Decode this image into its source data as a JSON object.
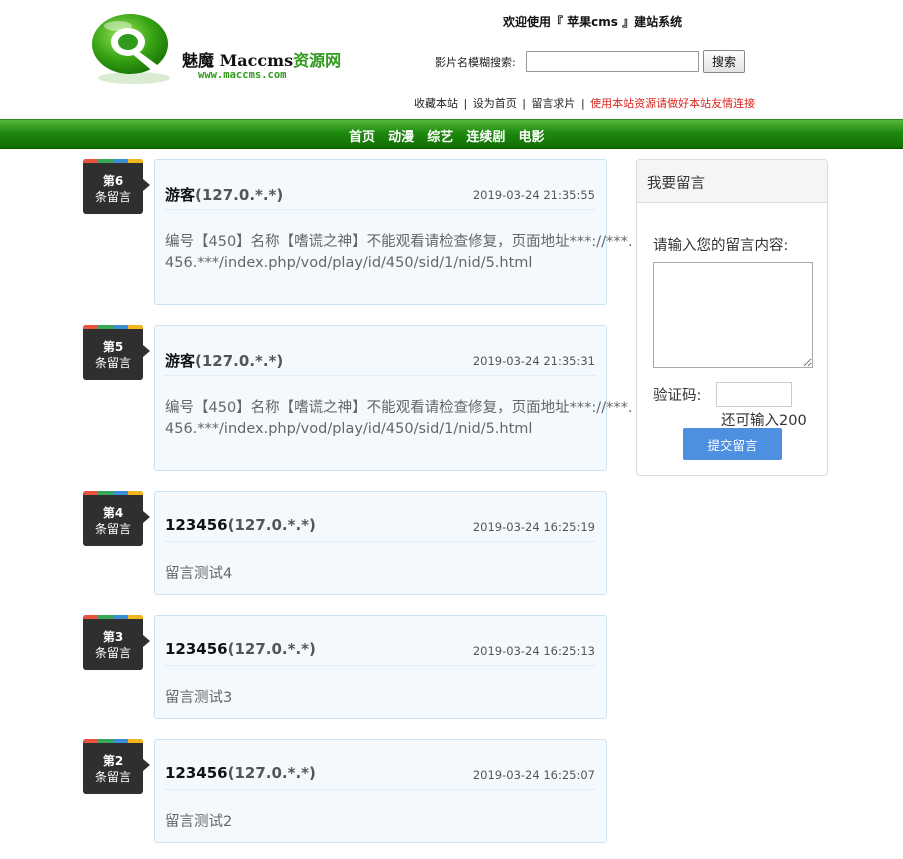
{
  "header": {
    "logo": {
      "name_black": "魅魔 Maccms",
      "name_green": "资源网",
      "url": "www.maccms.com"
    },
    "welcome": "欢迎使用『 苹果cms 』建站系统",
    "search": {
      "label": "影片名模糊搜索:",
      "value": "",
      "button": "搜索"
    },
    "links": [
      {
        "label": "收藏本站",
        "color": "#222222"
      },
      {
        "label": "设为首页",
        "color": "#222222"
      },
      {
        "label": "留言求片",
        "color": "#222222"
      },
      {
        "label": "使用本站资源请做好本站友情连接",
        "color": "#d8251f"
      }
    ],
    "link_separator": "|"
  },
  "nav": {
    "items": [
      "首页",
      "动漫",
      "综艺",
      "连续剧",
      "电影"
    ]
  },
  "messages": [
    {
      "badge_num": "第6",
      "badge_text": "条留言",
      "author": "游客",
      "ip": "(127.0.*.*)",
      "time": "2019-03-24 21:35:55",
      "content": "编号【450】名称【嗜谎之神】不能观看请检查修复，页面地址***://***.456.***/index.php/vod/play/id/450/sid/1/nid/5.html"
    },
    {
      "badge_num": "第5",
      "badge_text": "条留言",
      "author": "游客",
      "ip": "(127.0.*.*)",
      "time": "2019-03-24 21:35:31",
      "content": "编号【450】名称【嗜谎之神】不能观看请检查修复，页面地址***://***.456.***/index.php/vod/play/id/450/sid/1/nid/5.html"
    },
    {
      "badge_num": "第4",
      "badge_text": "条留言",
      "author": "123456",
      "ip": "(127.0.*.*)",
      "time": "2019-03-24 16:25:19",
      "content": "留言测试4"
    },
    {
      "badge_num": "第3",
      "badge_text": "条留言",
      "author": "123456",
      "ip": "(127.0.*.*)",
      "time": "2019-03-24 16:25:13",
      "content": "留言测试3"
    },
    {
      "badge_num": "第2",
      "badge_text": "条留言",
      "author": "123456",
      "ip": "(127.0.*.*)",
      "time": "2019-03-24 16:25:07",
      "content": "留言测试2"
    }
  ],
  "badge_stripe_colors": [
    "#e8523f",
    "#3aa65a",
    "#3b8fd9",
    "#f2b51c"
  ],
  "sidebar": {
    "title": "我要留言",
    "content_label": "请输入您的留言内容:",
    "content_value": "",
    "captcha_label": "验证码:",
    "captcha_value": "",
    "remain": "还可输入200",
    "submit": "提交留言"
  },
  "colors": {
    "nav_green": "#1f8a10",
    "brand_green": "#2f9a1c",
    "link_red": "#d8251f",
    "submit_blue": "#4d8fe0"
  }
}
